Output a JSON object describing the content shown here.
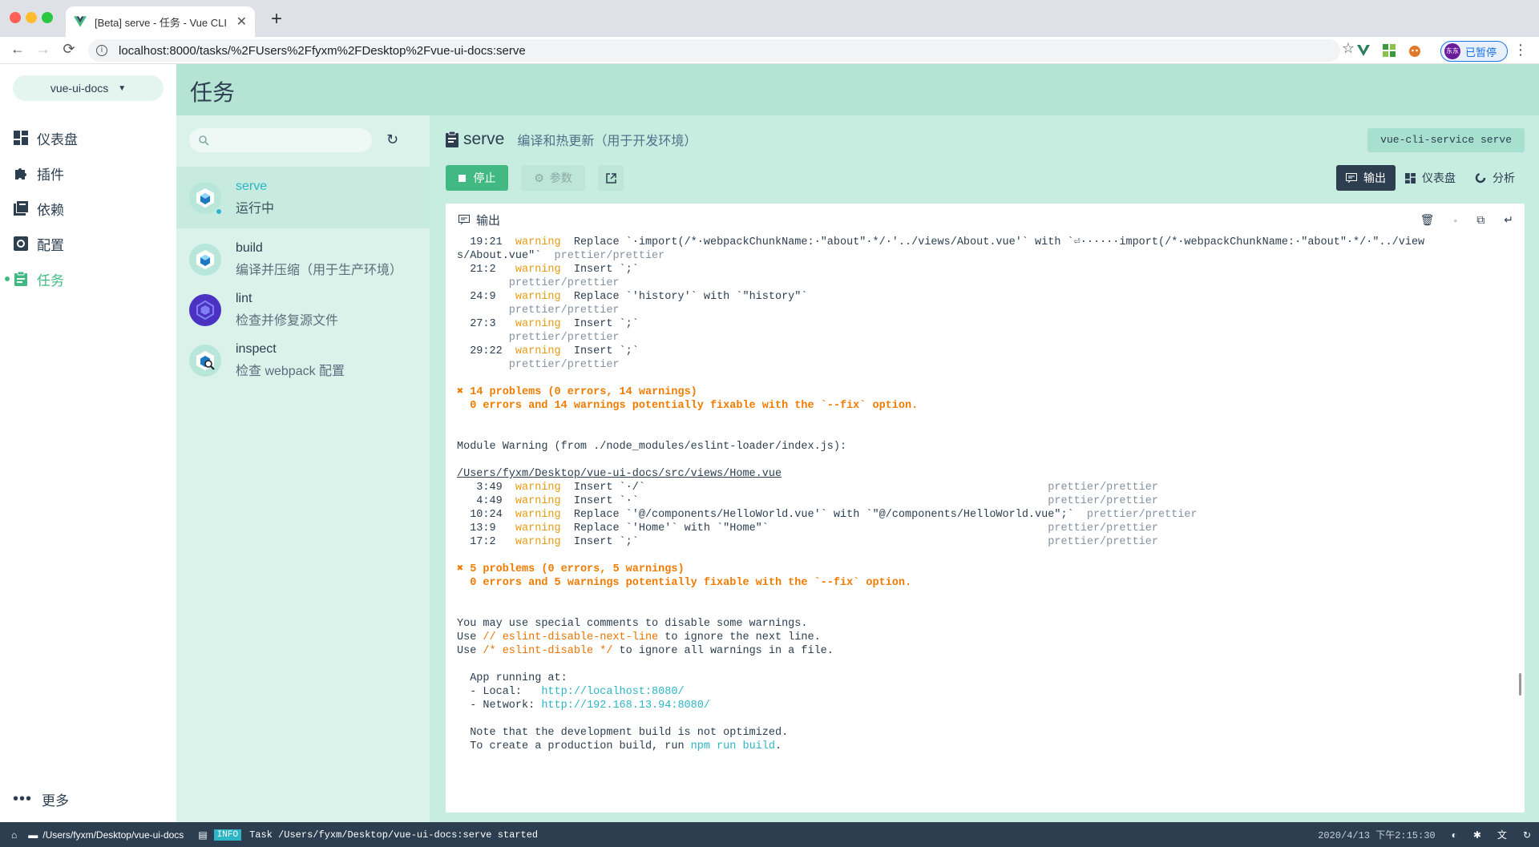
{
  "browser": {
    "tab_title": "[Beta] serve - 任务 - Vue CLI",
    "tab_close": "✕",
    "new_tab": "+",
    "url": "localhost:8000/tasks/%2FUsers%2Ffyxm%2FDesktop%2Fvue-ui-docs:serve",
    "profile_label": "已暂停",
    "profile_avatar": "东东"
  },
  "nav": {
    "project": "vue-ui-docs",
    "items": [
      {
        "label": "仪表盘"
      },
      {
        "label": "插件"
      },
      {
        "label": "依赖"
      },
      {
        "label": "配置"
      },
      {
        "label": "任务"
      }
    ],
    "more": "更多"
  },
  "header": {
    "title": "任务"
  },
  "tasks": [
    {
      "name": "serve",
      "desc": "运行中"
    },
    {
      "name": "build",
      "desc": "编译并压缩（用于生产环境）"
    },
    {
      "name": "lint",
      "desc": "检查并修复源文件"
    },
    {
      "name": "inspect",
      "desc": "检查 webpack 配置"
    }
  ],
  "detail": {
    "name": "serve",
    "description": "编译和热更新（用于开发环境）",
    "command": "vue-cli-service serve",
    "stop_label": "停止",
    "params_label": "参数",
    "views": [
      {
        "label": "输出"
      },
      {
        "label": "仪表盘"
      },
      {
        "label": "分析"
      }
    ],
    "output_title": "输出"
  },
  "terminal": {
    "l1": "  19:21  ",
    "l1w": "warning",
    "l1t": "  Replace `·import(/*·webpackChunkName:·\"about\"·*/·'../views/About.vue'` with `⏎······import(/*·webpackChunkName:·\"about\"·*/·\"../view",
    "l2": "s/About.vue\"`  ",
    "l2g": "prettier/prettier",
    "l3": "  21:2   ",
    "l3t": "  Insert `;`",
    "l4g": "        prettier/prettier",
    "l5": "  24:9   ",
    "l5t": "  Replace `'history'` with `\"history\"`",
    "l7": "  27:3   ",
    "l7t": "  Insert `;`",
    "l9": "  29:22  ",
    "l9t": "  Insert `;`",
    "warn": "warning",
    "pp": "        prettier/prettier",
    "p1a": "✖ 14 problems (0 errors, 14 warnings)",
    "p1b": "  0 errors and 14 warnings potentially fixable with the `--fix` option.",
    "mw": "Module Warning (from ./node_modules/eslint-loader/index.js):",
    "path": "/Users/fyxm/Desktop/vue-ui-docs/src/views/Home.vue",
    "h1": "   3:49  ",
    "h1t": "  Insert `·/`                                                              ",
    "h2": "   4:49  ",
    "h2t": "  Insert `·`                                                               ",
    "h3": "  10:24  ",
    "h3t": "  Replace `'@/components/HelloWorld.vue'` with `\"@/components/HelloWorld.vue\";`  ",
    "h4": "  13:9   ",
    "h4t": "  Replace `'Home'` with `\"Home\"`                                           ",
    "h5": "  17:2   ",
    "h5t": "  Insert `;`                                                               ",
    "ppr": "prettier/prettier",
    "p2a": "✖ 5 problems (0 errors, 5 warnings)",
    "p2b": "  0 errors and 5 warnings potentially fixable with the `--fix` option.",
    "s1": "You may use special comments to disable some warnings.",
    "s2a": "Use ",
    "s2b": "// eslint-disable-next-line",
    "s2c": " to ignore the next line.",
    "s3a": "Use ",
    "s3b": "/* eslint-disable */",
    "s3c": " to ignore all warnings in a file.",
    "a1": "  App running at:",
    "a2a": "  - Local:   ",
    "a2b": "http://localhost:8080/",
    "a3a": "  - Network: ",
    "a3b": "http://192.168.13.94:8080/",
    "n1": "  Note that the development build is not optimized.",
    "n2a": "  To create a production build, run ",
    "n2b": "npm run build",
    "n2c": "."
  },
  "status": {
    "cwd": "/Users/fyxm/Desktop/vue-ui-docs",
    "level": "INFO",
    "message": "Task /Users/fyxm/Desktop/vue-ui-docs:serve started",
    "datetime": "2020/4/13 下午2:15:30"
  },
  "colors": {
    "accent": "#42b983",
    "dark": "#2c3e50",
    "cyan": "#2db5c5"
  }
}
